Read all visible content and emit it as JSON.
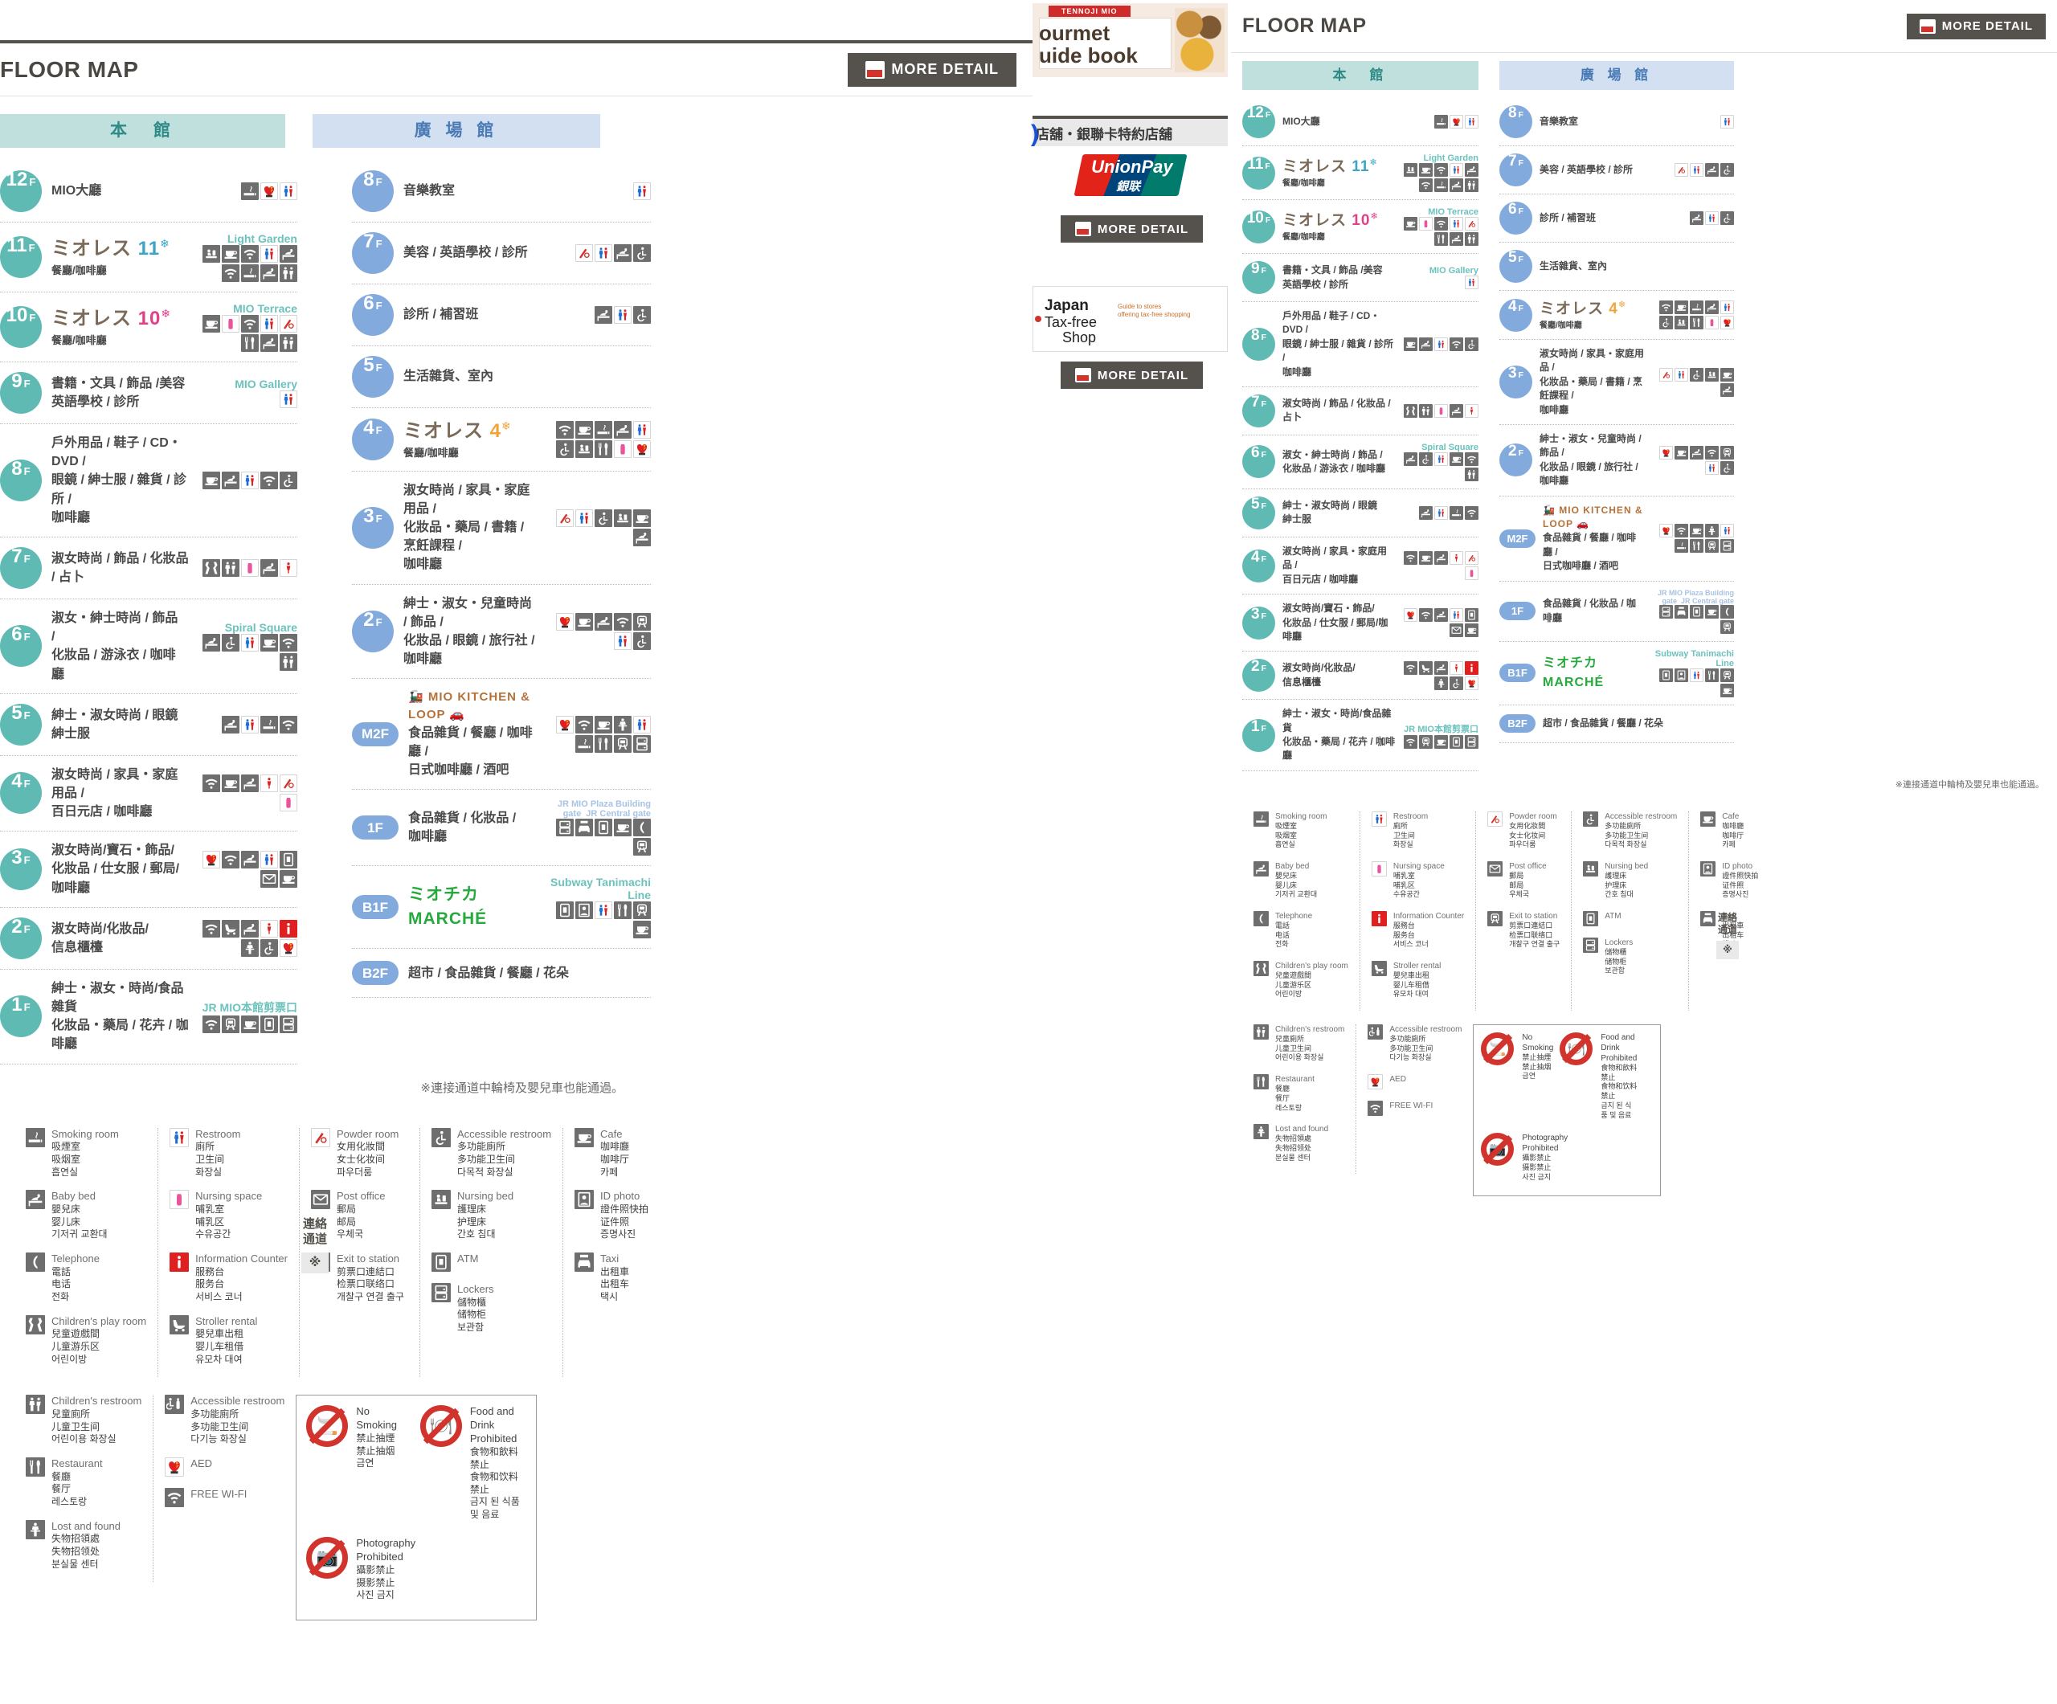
{
  "page": {
    "floor_map_title": "FLOOR MAP",
    "more_detail_label": "MORE DETAIL",
    "footnote": "※連接通道中輪椅及嬰兒車也能通過。",
    "connector_label_line1": "連絡",
    "connector_label_line2": "通道",
    "connector_mark": "※"
  },
  "buildings": {
    "honkan": "本　館",
    "hiroba": "廣 場 館"
  },
  "honkan_floors": [
    {
      "floor": "12",
      "suffix": "F",
      "text": "MIO大廳",
      "zone": "",
      "icons": [
        "smoking",
        "aed",
        "restroom"
      ]
    },
    {
      "floor": "11",
      "suffix": "F",
      "logo": "ミオレス",
      "logo_num": "11",
      "sub": "餐廳/咖啡廳",
      "zone": "Light Garden",
      "icons": [
        "nursing-bed",
        "cafe",
        "wifi",
        "restroom",
        "baby-bed",
        "wifi",
        "smoking",
        "baby-bed",
        "childrens-restroom"
      ]
    },
    {
      "floor": "10",
      "suffix": "F",
      "logo": "ミオレス",
      "logo_num": "10",
      "sub": "餐廳/咖啡廳",
      "zone": "MIO Terrace",
      "icons": [
        "cafe",
        "nursing-space",
        "wifi",
        "restroom",
        "powder-room",
        "restaurant",
        "baby-bed",
        "childrens-restroom"
      ]
    },
    {
      "floor": "9",
      "suffix": "F",
      "text": "書籍・文具 / 飾品 /美容",
      "text2": "英語學校 / 診所",
      "zone": "MIO Gallery",
      "icons": [
        "restroom"
      ]
    },
    {
      "floor": "8",
      "suffix": "F",
      "text": "戶外用品 / 鞋子 / CD・DVD /",
      "text2": "眼鏡 / 紳士服 / 雜貨 / 診所 /",
      "text3": "咖啡廳",
      "zone": "",
      "icons": [
        "cafe",
        "baby-bed",
        "restroom",
        "wifi",
        "accessible-restroom"
      ]
    },
    {
      "floor": "7",
      "suffix": "F",
      "text": "淑女時尚 / 飾品 / 化妝品 / 占卜",
      "zone": "",
      "icons": [
        "childrens-play",
        "childrens-restroom",
        "nursing-space",
        "baby-bed",
        "ladies-restroom"
      ]
    },
    {
      "floor": "6",
      "suffix": "F",
      "text": "淑女・紳士時尚 / 飾品 /",
      "text2": "化妝品 / 游泳衣 / 咖啡廳",
      "zone": "Spiral Square",
      "icons": [
        "baby-bed",
        "accessible-restroom",
        "restroom",
        "cafe",
        "wifi",
        "childrens-restroom"
      ]
    },
    {
      "floor": "5",
      "suffix": "F",
      "text": "紳士・淑女時尚 / 眼鏡",
      "text2": "紳士服",
      "zone": "",
      "icons": [
        "baby-bed",
        "restroom",
        "smoking",
        "wifi"
      ]
    },
    {
      "floor": "4",
      "suffix": "F",
      "text": "淑女時尚 / 家具・家庭用品 /",
      "text2": "百日元店 / 咖啡廳",
      "zone": "",
      "icons": [
        "wifi",
        "cafe",
        "baby-bed",
        "ladies-restroom",
        "powder-room",
        "nursing-space"
      ]
    },
    {
      "floor": "3",
      "suffix": "F",
      "text": "淑女時尚/寶石・飾品/",
      "text2": "化妝品 / 仕女服 / 郵局/咖啡廳",
      "zone": "",
      "icons": [
        "aed",
        "wifi",
        "baby-bed",
        "restroom",
        "atm",
        "post-office",
        "cafe"
      ]
    },
    {
      "floor": "2",
      "suffix": "F",
      "text": "淑女時尚/化妝品/",
      "text2": "信息櫃檯",
      "zone": "",
      "icons": [
        "wifi",
        "stroller",
        "baby-bed",
        "ladies-restroom",
        "information",
        "lost-found",
        "accessible-restroom",
        "aed"
      ]
    },
    {
      "floor": "1",
      "suffix": "F",
      "text": "紳士・淑女・時尚/食品雜貨",
      "text2": "化妝品・藥局 / 花卉 / 咖啡廳",
      "zone": "JR MIO本館剪票口",
      "icons": [
        "wifi",
        "exit-station",
        "cafe",
        "atm",
        "lockers"
      ]
    }
  ],
  "hiroba_floors": [
    {
      "floor": "8",
      "suffix": "F",
      "text": "音樂教室",
      "zone": "",
      "icons": [
        "restroom"
      ]
    },
    {
      "floor": "7",
      "suffix": "F",
      "text": "美容 / 英語學校 / 診所",
      "zone": "",
      "icons": [
        "powder-room",
        "restroom",
        "baby-bed",
        "accessible-restroom"
      ]
    },
    {
      "floor": "6",
      "suffix": "F",
      "text": "診所 / 補習班",
      "zone": "",
      "icons": [
        "baby-bed",
        "restroom",
        "accessible-restroom"
      ]
    },
    {
      "floor": "5",
      "suffix": "F",
      "text": "生活雜貨、室內",
      "zone": "",
      "icons": []
    },
    {
      "floor": "4",
      "suffix": "F",
      "logo": "ミオレス",
      "logo_num": "4",
      "sub": "餐廳/咖啡廳",
      "zone": "",
      "icons": [
        "wifi",
        "cafe",
        "smoking",
        "baby-bed",
        "restroom",
        "accessible-restroom",
        "nursing-bed",
        "restaurant",
        "nursing-space",
        "aed"
      ]
    },
    {
      "floor": "3",
      "suffix": "F",
      "text": "淑女時尚 / 家具・家庭用品 /",
      "text2": "化妝品・藥局 / 書籍 / 烹飪課程 /",
      "text3": "咖啡廳",
      "zone": "",
      "icons": [
        "powder-room",
        "restroom",
        "accessible-restroom",
        "nursing-bed",
        "cafe",
        "baby-bed"
      ]
    },
    {
      "floor": "2",
      "suffix": "F",
      "text": "紳士・淑女・兒童時尚 / 飾品 /",
      "text2": "化妝品 / 眼鏡 / 旅行社 / 咖啡廳",
      "zone": "",
      "icons": [
        "aed",
        "cafe",
        "baby-bed",
        "wifi",
        "exit-station",
        "restroom",
        "accessible-restroom"
      ]
    },
    {
      "floor": "M2F",
      "pill": true,
      "logo_brand": "MIO KITCHEN & LOOP",
      "text": "食品雜貨 / 餐廳 / 咖啡廳 /",
      "text2": "日式咖啡廳 / 酒吧",
      "zone": "",
      "icons": [
        "aed",
        "wifi",
        "cafe",
        "lost-found",
        "restroom",
        "smoking",
        "restaurant",
        "exit-station",
        "lockers"
      ]
    },
    {
      "floor": "1F",
      "pill": true,
      "text": "食品雜貨 / 化妝品 / 咖啡廳",
      "zone_a": "JR MIO Plaza Building gate",
      "zone_b": "JR Central gate",
      "icons": [
        "lockers",
        "taxi",
        "atm",
        "cafe",
        "telephone",
        "exit-station"
      ]
    },
    {
      "floor": "B1F",
      "pill": true,
      "logo_brand2": "ミオチカ MARCHÉ",
      "zone": "Subway Tanimachi Line",
      "icons": [
        "atm",
        "id-photo",
        "restroom",
        "restaurant",
        "exit-station",
        "cafe"
      ]
    },
    {
      "floor": "B2F",
      "pill": true,
      "text": "超市 / 食品雜貨 / 餐廳 / 花朵",
      "zone": "",
      "icons": []
    }
  ],
  "legend_columns": [
    [
      {
        "icon": "smoking",
        "en": "Smoking room",
        "zh_t": "吸煙室",
        "zh_s": "吸烟室",
        "ko": "흡연실"
      },
      {
        "icon": "baby-bed",
        "en": "Baby bed",
        "zh_t": "嬰兒床",
        "zh_s": "婴儿床",
        "ko": "기저귀 교환대"
      },
      {
        "icon": "telephone",
        "en": "Telephone",
        "zh_t": "電話",
        "zh_s": "电话",
        "ko": "전화"
      },
      {
        "icon": "childrens-play",
        "en": "Children's play room",
        "zh_t": "兒童遊戲間",
        "zh_s": "儿童游乐区",
        "ko": "어린이방"
      }
    ],
    [
      {
        "icon": "restroom",
        "en": "Restroom",
        "zh_t": "廁所",
        "zh_s": "卫生间",
        "ko": "화장실"
      },
      {
        "icon": "nursing-space",
        "en": "Nursing space",
        "zh_t": "哺乳室",
        "zh_s": "哺乳区",
        "ko": "수유공간"
      },
      {
        "icon": "information",
        "en": "Information Counter",
        "zh_t": "服務台",
        "zh_s": "服务台",
        "ko": "서비스 코너"
      },
      {
        "icon": "stroller",
        "en": "Stroller rental",
        "zh_t": "嬰兒車出租",
        "zh_s": "婴儿车租借",
        "ko": "유모차 대여"
      }
    ],
    [
      {
        "icon": "powder-room",
        "en": "Powder room",
        "zh_t": "女用化妝間",
        "zh_s": "女士化妆间",
        "ko": "파우더룸"
      },
      {
        "icon": "post-office",
        "en": "Post office",
        "zh_t": "郵局",
        "zh_s": "邮局",
        "ko": "우체국"
      },
      {
        "icon": "exit-station",
        "en": "Exit to station",
        "zh_t": "剪票口連結口",
        "zh_s": "检票口联络口",
        "ko": "개찰구 연결 출구"
      }
    ],
    [
      {
        "icon": "accessible-restroom",
        "en": "Accessible restroom",
        "zh_t": "多功能廁所",
        "zh_s": "多功能卫生间",
        "ko": "다목적 화장실"
      },
      {
        "icon": "nursing-bed",
        "en": "Nursing bed",
        "zh_t": "護理床",
        "zh_s": "护理床",
        "ko": "간호 침대"
      },
      {
        "icon": "atm",
        "en": "ATM",
        "zh_t": "",
        "zh_s": "",
        "ko": ""
      },
      {
        "icon": "lockers",
        "en": "Lockers",
        "zh_t": "儲物櫃",
        "zh_s": "储物柜",
        "ko": "보관함"
      }
    ],
    [
      {
        "icon": "cafe",
        "en": "Cafe",
        "zh_t": "咖啡廳",
        "zh_s": "咖啡厅",
        "ko": "카페"
      },
      {
        "icon": "id-photo",
        "en": "ID photo",
        "zh_t": "證件照快拍",
        "zh_s": "证件照",
        "ko": "증명사진"
      },
      {
        "icon": "taxi",
        "en": "Taxi",
        "zh_t": "出租車",
        "zh_s": "出租车",
        "ko": "택시"
      }
    ]
  ],
  "legend_columns_row2": [
    [
      {
        "icon": "childrens-restroom",
        "en": "Children's restroom",
        "zh_t": "兒童廁所",
        "zh_s": "儿童卫生间",
        "ko": "어린이용 화장실"
      },
      {
        "icon": "restaurant",
        "en": "Restaurant",
        "zh_t": "餐廳",
        "zh_s": "餐厅",
        "ko": "레스토랑"
      },
      {
        "icon": "lost-found",
        "en": "Lost and found",
        "zh_t": "失物招領處",
        "zh_s": "失物招领处",
        "ko": "분실물 센터"
      }
    ],
    [
      {
        "icon": "accessible-restroom2",
        "en": "Accessible restroom",
        "zh_t": "多功能廁所",
        "zh_s": "多功能卫生间",
        "ko": "다기능 화장실"
      },
      {
        "icon": "aed",
        "en": "AED",
        "zh_t": "",
        "zh_s": "",
        "ko": ""
      },
      {
        "icon": "wifi",
        "en": "FREE WI-FI",
        "zh_t": "",
        "zh_s": "",
        "ko": ""
      }
    ]
  ],
  "prohibitions": [
    {
      "icon": "no-smoking",
      "en": "No Smoking",
      "zh_t": "禁止抽煙",
      "zh_s": "禁止抽烟",
      "ko": "금연"
    },
    {
      "icon": "no-food-drink",
      "en": "Food and Drink Prohibited",
      "zh_t": "食物和飲料禁止",
      "zh_s": "食物和饮料禁止",
      "ko": "금지 된 식품 및 음료"
    },
    {
      "icon": "no-photography",
      "en": "Photography Prohibited",
      "zh_t": "攝影禁止",
      "zh_s": "摄影禁止",
      "ko": "사진 금지"
    }
  ],
  "promos": {
    "gourmet_ribbon": "TENNOJI MIO",
    "gourmet_title1": "ourmet",
    "gourmet_title2": "uide book",
    "unionpay_header": "店舖・銀聯卡特約店舖",
    "unionpay_brand": "UnionPay",
    "unionpay_cn": "銀联",
    "taxfree_title1": "Japan",
    "taxfree_title2": "Tax-free",
    "taxfree_title3": "Shop",
    "taxfree_sub1": "Guide to stores",
    "taxfree_sub2": "offering tax-free shopping"
  }
}
